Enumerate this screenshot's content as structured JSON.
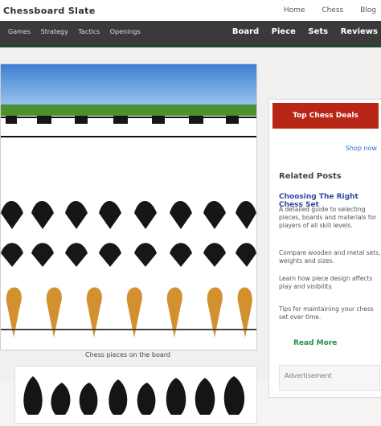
{
  "header": {
    "logo_text": "Chessboard Slate",
    "top_nav": [
      "Home",
      "Chess",
      "Blog"
    ]
  },
  "navbar": {
    "left_items": [
      "Games",
      "Strategy",
      "Tactics",
      "Openings"
    ],
    "right_items": [
      "Board",
      "Piece",
      "Sets",
      "Reviews"
    ]
  },
  "main": {
    "image_caption": "Chess pieces on the board"
  },
  "sidebar": {
    "promo_text": "Top Chess Deals",
    "promo_link": "Shop now",
    "title": "Related Posts",
    "subtitle": "Choosing The Right Chess Set",
    "text_1": "A detailed guide to selecting pieces, boards and materials for players of all skill levels.",
    "text_2": "Compare wooden and metal sets, weights and sizes.",
    "text_3": "Learn how piece design affects play and visibility.",
    "text_4": "Tips for maintaining your chess set over time.",
    "link_text": "Read More",
    "footer_text": "Advertisement"
  },
  "colors": {
    "dark_green": "#1b4a2d",
    "accent_red": "#b82617",
    "piece_dark": "#161616",
    "piece_light": "#d2912f"
  },
  "icons": {
    "piece_icon_dark": "black-chess-piece-icon",
    "piece_icon_light": "orange-chess-piece-icon"
  }
}
